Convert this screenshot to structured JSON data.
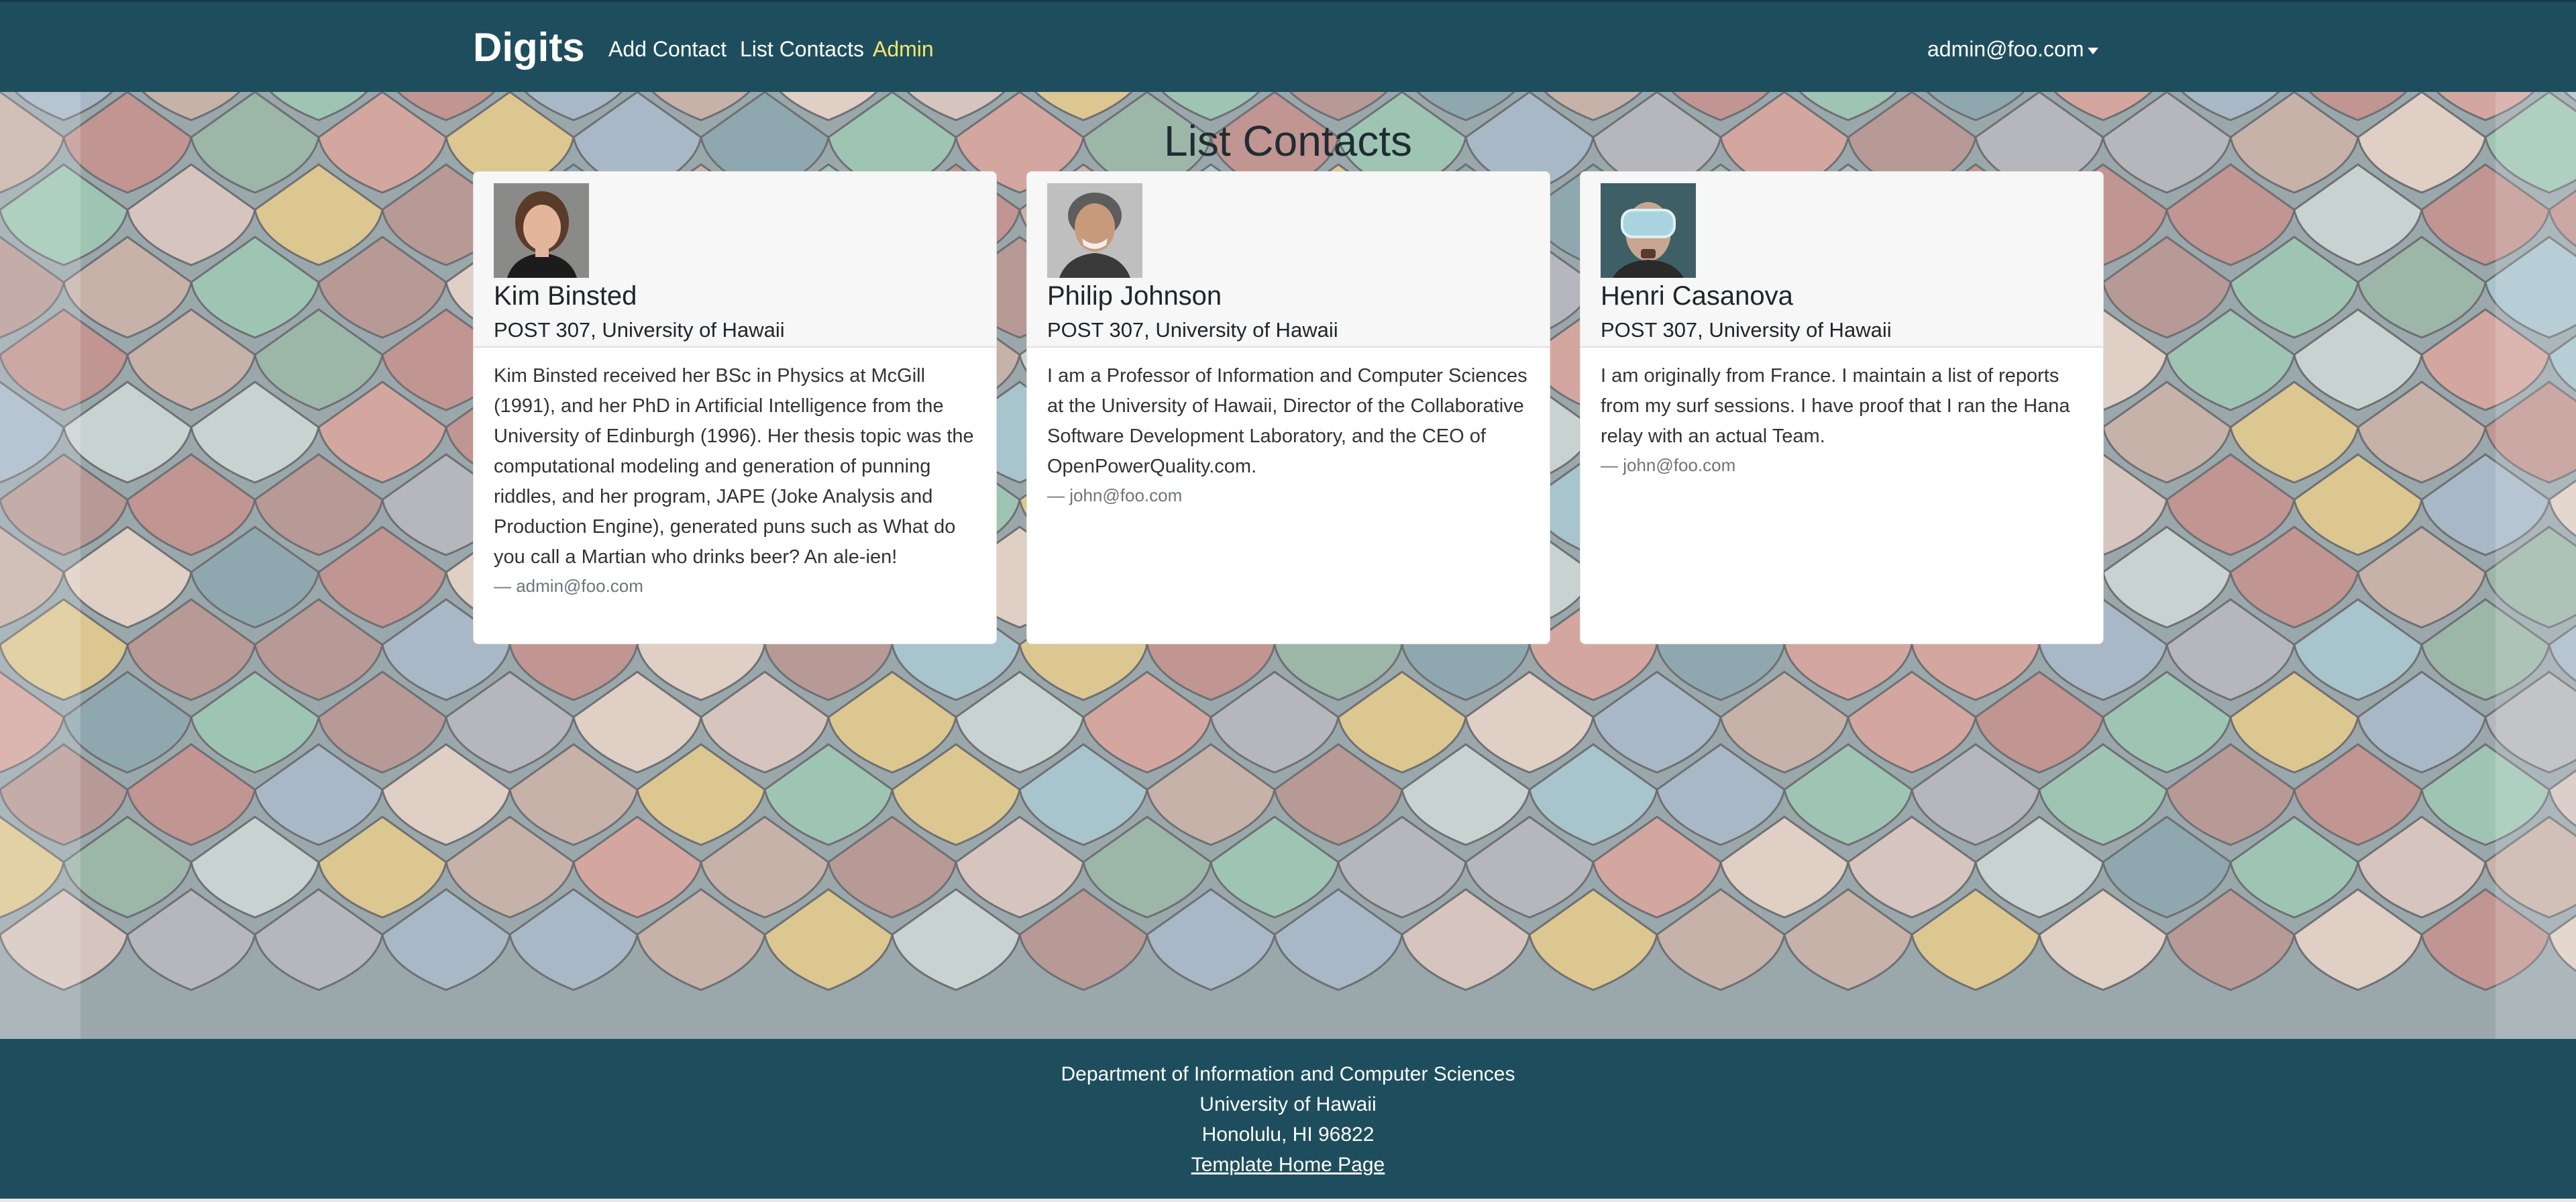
{
  "navbar": {
    "brand": "Digits",
    "links": [
      {
        "label": "Add Contact"
      },
      {
        "label": "List Contacts"
      },
      {
        "label": "Admin"
      }
    ],
    "user": "admin@foo.com"
  },
  "page": {
    "title": "List Contacts"
  },
  "contacts": [
    {
      "name": "Kim Binsted",
      "address": "POST 307, University of Hawaii",
      "description": "Kim Binsted received her BSc in Physics at McGill (1991), and her PhD in Artificial Intelligence from the University of Edinburgh (1996). Her thesis topic was the computational modeling and generation of punning riddles, and her program, JAPE (Joke Analysis and Production Engine), generated puns such as What do you call a Martian who drinks beer? An ale-ien!",
      "owner": "— admin@foo.com"
    },
    {
      "name": "Philip Johnson",
      "address": "POST 307, University of Hawaii",
      "description": "I am a Professor of Information and Computer Sciences at the University of Hawaii, Director of the Collaborative Software Development Laboratory, and the CEO of OpenPowerQuality.com.",
      "owner": "— john@foo.com"
    },
    {
      "name": "Henri Casanova",
      "address": "POST 307, University of Hawaii",
      "description": "I am originally from France. I maintain a list of reports from my surf sessions. I have proof that I ran the Hana relay with an actual Team.",
      "owner": "— john@foo.com"
    }
  ],
  "footer": {
    "lines": [
      "Department of Information and Computer Sciences",
      "University of Hawaii",
      "Honolulu, HI 96822"
    ],
    "link": "Template Home Page"
  },
  "colors": {
    "navbar": "#1e4e5e",
    "admin_link": "#f5e76a",
    "footer": "#1e4e5e"
  }
}
